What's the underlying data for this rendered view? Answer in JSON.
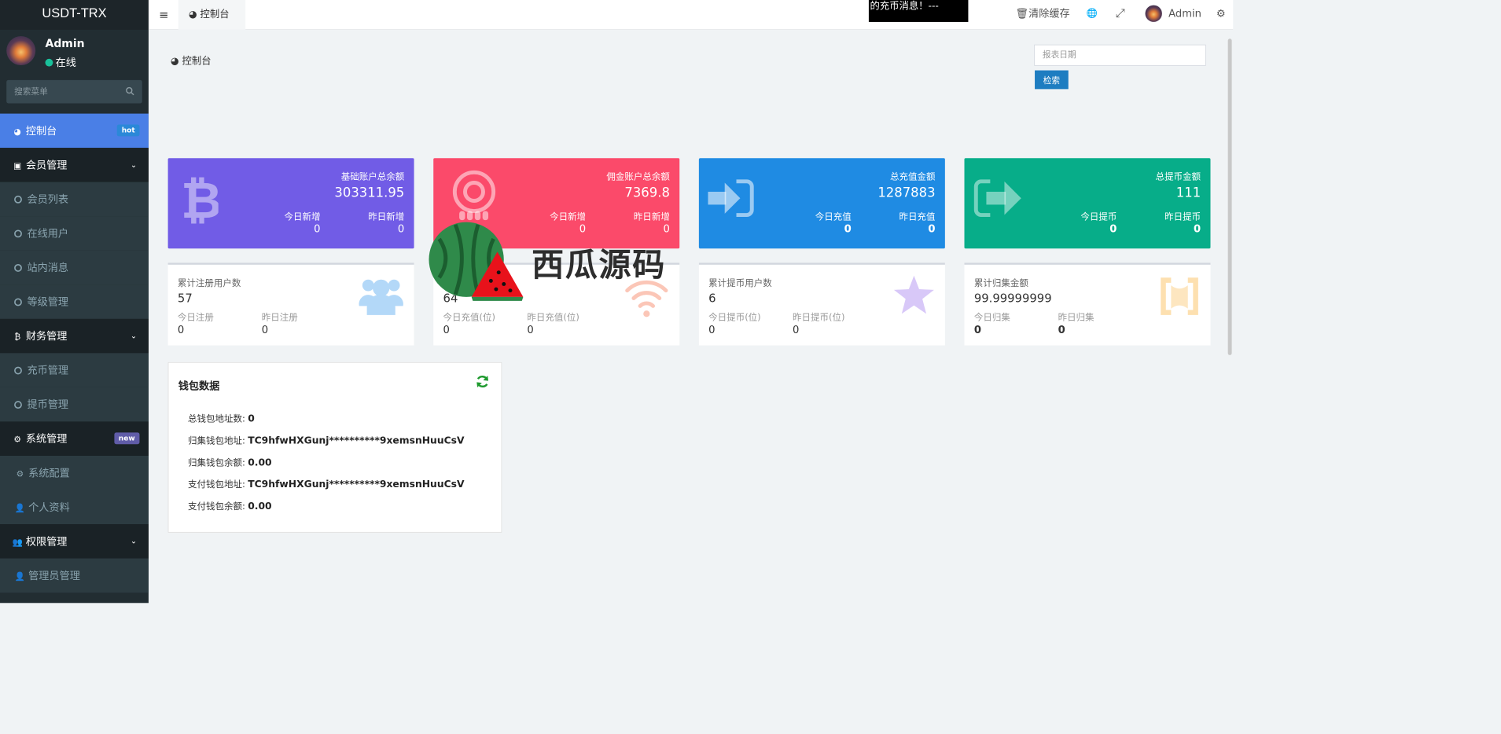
{
  "app": {
    "title": "USDT-TRX"
  },
  "user": {
    "name": "Admin",
    "status": "在线"
  },
  "sidebar": {
    "search_placeholder": "搜索菜单",
    "items": [
      {
        "label": "控制台",
        "badge": "hot"
      },
      {
        "label": "会员管理"
      },
      {
        "label": "会员列表"
      },
      {
        "label": "在线用户"
      },
      {
        "label": "站内消息"
      },
      {
        "label": "等级管理"
      },
      {
        "label": "财务管理"
      },
      {
        "label": "充币管理"
      },
      {
        "label": "提币管理"
      },
      {
        "label": "系统管理",
        "badge": "new"
      },
      {
        "label": "系统配置"
      },
      {
        "label": "个人资料"
      },
      {
        "label": "权限管理"
      },
      {
        "label": "管理员管理"
      }
    ]
  },
  "header": {
    "tab": "控制台",
    "marquee": "的充币消息！---",
    "clear_cache": "清除缓存",
    "admin": "Admin"
  },
  "content": {
    "breadcrumb": "控制台",
    "date_placeholder": "报表日期",
    "search_btn": "检索"
  },
  "cards": [
    {
      "title": "基础账户总余额",
      "value": "303311.95",
      "lab1": "今日新增",
      "lab2": "昨日新增",
      "val1": "0",
      "val2": "0",
      "color": "#715ce6"
    },
    {
      "title": "佣金账户总余额",
      "value": "7369.8",
      "lab1": "今日新增",
      "lab2": "昨日新增",
      "val1": "0",
      "val2": "0",
      "color": "#fb4a6a"
    },
    {
      "title": "总充值金额",
      "value": "1287883",
      "lab1": "今日充值",
      "lab2": "昨日充值",
      "val1": "0",
      "val2": "0",
      "color": "#1f8be3"
    },
    {
      "title": "总提币金额",
      "value": "111",
      "lab1": "今日提币",
      "lab2": "昨日提币",
      "val1": "0",
      "val2": "0",
      "color": "#07ad89"
    }
  ],
  "wcards": [
    {
      "title": "累计注册用户数",
      "value": "57",
      "lab1": "今日注册",
      "lab2": "昨日注册",
      "val1": "0",
      "val2": "0"
    },
    {
      "title": "",
      "value": "64",
      "lab1": "今日充值(位)",
      "lab2": "昨日充值(位)",
      "val1": "0",
      "val2": "0"
    },
    {
      "title": "累计提币用户数",
      "value": "6",
      "lab1": "今日提币(位)",
      "lab2": "昨日提币(位)",
      "val1": "0",
      "val2": "0"
    },
    {
      "title": "累计归集金额",
      "value": "99.99999999",
      "lab1": "今日归集",
      "lab2": "昨日归集",
      "val1": "0",
      "val2": "0"
    }
  ],
  "wallet": {
    "title": "钱包数据",
    "rows": [
      {
        "label": "总钱包地址数:",
        "value": "0"
      },
      {
        "label": "归集钱包地址:",
        "value": "TC9hfwHXGunj**********9xemsnHuuCsV"
      },
      {
        "label": "归集钱包余额:",
        "value": "0.00"
      },
      {
        "label": "支付钱包地址:",
        "value": "TC9hfwHXGunj**********9xemsnHuuCsV"
      },
      {
        "label": "支付钱包余额:",
        "value": "0.00"
      }
    ]
  },
  "watermark": {
    "text": "西瓜源码"
  }
}
